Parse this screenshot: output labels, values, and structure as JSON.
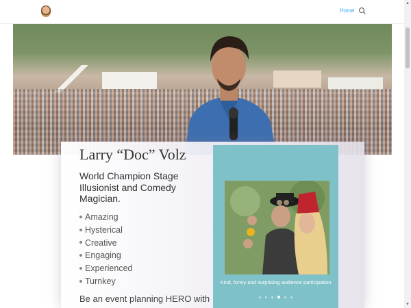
{
  "header": {
    "nav_home": "Home",
    "search_icon": "search-icon",
    "accent_color": "#2ea3f2"
  },
  "hero": {
    "image": "performer-at-festival-crowd"
  },
  "profile": {
    "name": "Larry “Doc” Volz",
    "subtitle": "World Champion Stage Illusionist and Comedy Magician.",
    "features": [
      "Amazing",
      "Hysterical",
      "Creative",
      "Engaging",
      "Experienced",
      "Turnkey"
    ],
    "cta": "Be an event planning HERO with"
  },
  "slider": {
    "background": "#7fc1c8",
    "caption": "Kind, funny and surprising audience participation",
    "dot_count": 6,
    "active_dot": 3
  }
}
